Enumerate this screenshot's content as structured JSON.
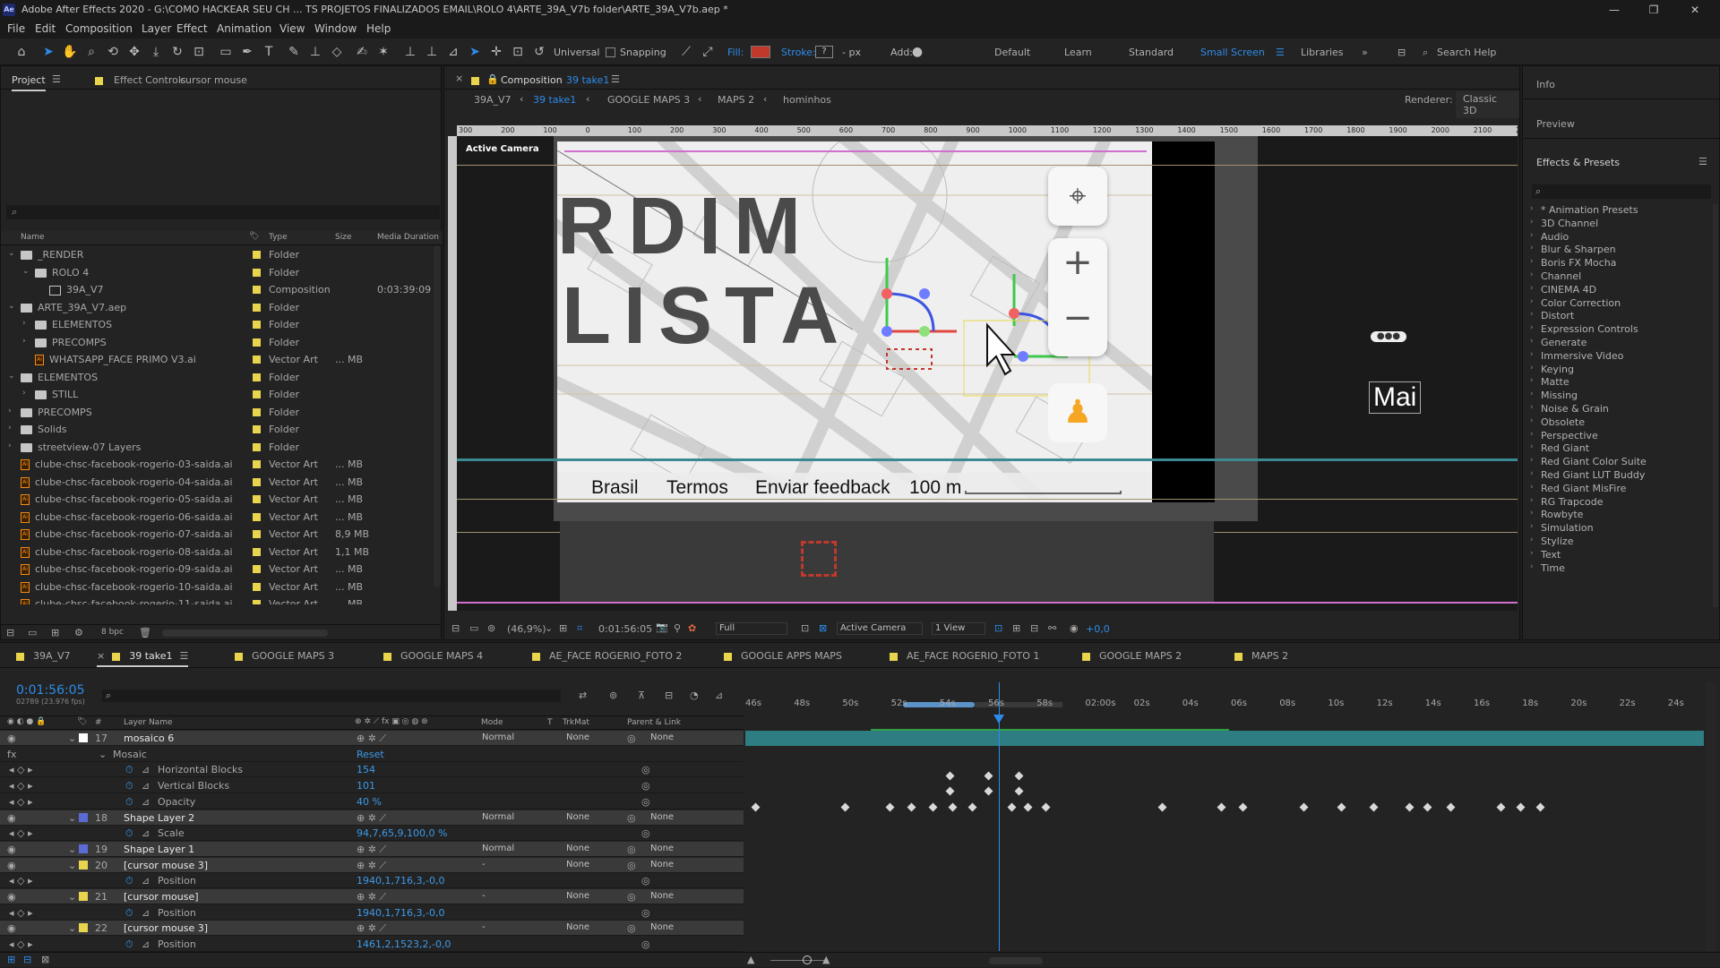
{
  "titlebar": {
    "logo": "Ae",
    "title": "Adobe After Effects 2020 - G:\\COMO HACKEAR SEU CH ... TS PROJETOS FINALIZADOS EMAIL\\ROLO 4\\ARTE_39A_V7b folder\\ARTE_39A_V7b.aep *",
    "minimize": "—",
    "restore": "❐",
    "close": "✕"
  },
  "menu": [
    "File",
    "Edit",
    "Composition",
    "Layer",
    "Effect",
    "Animation",
    "View",
    "Window",
    "Help"
  ],
  "toolbar": {
    "universal": "Universal",
    "snapping": "Snapping",
    "fill": "Fill:",
    "stroke": "Stroke:",
    "stroke_q": "?",
    "px": "- px",
    "add": "Add:",
    "workspaces": [
      "Default",
      "Learn",
      "Standard",
      "Small Screen",
      "Libraries"
    ],
    "active_workspace": "Small Screen",
    "search": "Search Help"
  },
  "project": {
    "tab": "Project",
    "effect_tab": "Effect Controls",
    "effect_target": "cursor mouse",
    "cols": {
      "name": "Name",
      "type": "Type",
      "size": "Size",
      "duration": "Media Duration"
    },
    "rows": [
      {
        "indent": 0,
        "exp": "⌄",
        "icon": "folder",
        "name": "_RENDER",
        "type": "Folder",
        "size": "",
        "dur": ""
      },
      {
        "indent": 1,
        "exp": "⌄",
        "icon": "folder",
        "name": "ROLO 4",
        "type": "Folder",
        "size": "",
        "dur": ""
      },
      {
        "indent": 2,
        "exp": "",
        "icon": "comp",
        "name": "39A_V7",
        "type": "Composition",
        "size": "",
        "dur": "0:03:39:09"
      },
      {
        "indent": 0,
        "exp": "⌄",
        "icon": "folder",
        "name": "ARTE_39A_V7.aep",
        "type": "Folder",
        "size": "",
        "dur": ""
      },
      {
        "indent": 1,
        "exp": "›",
        "icon": "folder",
        "name": "ELEMENTOS",
        "type": "Folder",
        "size": "",
        "dur": ""
      },
      {
        "indent": 1,
        "exp": "›",
        "icon": "folder",
        "name": "PRECOMPS",
        "type": "Folder",
        "size": "",
        "dur": ""
      },
      {
        "indent": 1,
        "exp": "",
        "icon": "ai",
        "name": "WHATSAPP_FACE PRIMO V3.ai",
        "type": "Vector Art",
        "size": "... MB",
        "dur": ""
      },
      {
        "indent": 0,
        "exp": "⌄",
        "icon": "folder",
        "name": "ELEMENTOS",
        "type": "Folder",
        "size": "",
        "dur": ""
      },
      {
        "indent": 1,
        "exp": "›",
        "icon": "folder",
        "name": "STILL",
        "type": "Folder",
        "size": "",
        "dur": ""
      },
      {
        "indent": 0,
        "exp": "›",
        "icon": "folder",
        "name": "PRECOMPS",
        "type": "Folder",
        "size": "",
        "dur": ""
      },
      {
        "indent": 0,
        "exp": "›",
        "icon": "folder",
        "name": "Solids",
        "type": "Folder",
        "size": "",
        "dur": ""
      },
      {
        "indent": 0,
        "exp": "›",
        "icon": "folder",
        "name": "streetview-07 Layers",
        "type": "Folder",
        "size": "",
        "dur": ""
      },
      {
        "indent": 0,
        "exp": "",
        "icon": "ai",
        "name": "clube-chsc-facebook-rogerio-03-saida.ai",
        "type": "Vector Art",
        "size": "... MB",
        "dur": ""
      },
      {
        "indent": 0,
        "exp": "",
        "icon": "ai",
        "name": "clube-chsc-facebook-rogerio-04-saida.ai",
        "type": "Vector Art",
        "size": "... MB",
        "dur": ""
      },
      {
        "indent": 0,
        "exp": "",
        "icon": "ai",
        "name": "clube-chsc-facebook-rogerio-05-saida.ai",
        "type": "Vector Art",
        "size": "... MB",
        "dur": ""
      },
      {
        "indent": 0,
        "exp": "",
        "icon": "ai",
        "name": "clube-chsc-facebook-rogerio-06-saida.ai",
        "type": "Vector Art",
        "size": "... MB",
        "dur": ""
      },
      {
        "indent": 0,
        "exp": "",
        "icon": "ai",
        "name": "clube-chsc-facebook-rogerio-07-saida.ai",
        "type": "Vector Art",
        "size": "8,9 MB",
        "dur": ""
      },
      {
        "indent": 0,
        "exp": "",
        "icon": "ai",
        "name": "clube-chsc-facebook-rogerio-08-saida.ai",
        "type": "Vector Art",
        "size": "1,1 MB",
        "dur": ""
      },
      {
        "indent": 0,
        "exp": "",
        "icon": "ai",
        "name": "clube-chsc-facebook-rogerio-09-saida.ai",
        "type": "Vector Art",
        "size": "... MB",
        "dur": ""
      },
      {
        "indent": 0,
        "exp": "",
        "icon": "ai",
        "name": "clube-chsc-facebook-rogerio-10-saida.ai",
        "type": "Vector Art",
        "size": "... MB",
        "dur": ""
      },
      {
        "indent": 0,
        "exp": "",
        "icon": "ai",
        "name": "clube-chsc-facebook-rogerio-11-saida.ai",
        "type": "Vector Art",
        "size": "... MB",
        "dur": ""
      }
    ],
    "bpc": "8 bpc"
  },
  "viewer": {
    "tab_prefix": "Composition",
    "tab_name": "39 take1",
    "breadcrumbs": [
      "39A_V7",
      "39 take1",
      "GOOGLE MAPS 3",
      "MAPS 2",
      "hominhos"
    ],
    "renderer_label": "Renderer:",
    "renderer": "Classic 3D",
    "active_camera": "Active Camera",
    "ruler": [
      "300",
      "200",
      "100",
      "0",
      "100",
      "200",
      "300",
      "400",
      "500",
      "600",
      "700",
      "800",
      "900",
      "1000",
      "1100",
      "1200",
      "1300",
      "1400",
      "1500",
      "1600",
      "1700",
      "1800",
      "1900",
      "2000",
      "2100",
      "2"
    ],
    "map_text_1": "RDIM",
    "map_text_2": "LISTA",
    "footer": [
      "Brasil",
      "Termos",
      "Enviar feedback",
      "100 m"
    ],
    "mai": "Mai",
    "zoom": "(46,9%)",
    "time": "0:01:56:05",
    "quality": "Full",
    "camera": "Active Camera",
    "views": "1 View",
    "exposure": "+0,0"
  },
  "info": {
    "info": "Info",
    "preview": "Preview",
    "effects": "Effects & Presets",
    "list": [
      "* Animation Presets",
      "3D Channel",
      "Audio",
      "Blur & Sharpen",
      "Boris FX Mocha",
      "Channel",
      "CINEMA 4D",
      "Color Correction",
      "Distort",
      "Expression Controls",
      "Generate",
      "Immersive Video",
      "Keying",
      "Matte",
      "Missing",
      "Noise & Grain",
      "Obsolete",
      "Perspective",
      "Red Giant",
      "Red Giant Color Suite",
      "Red Giant LUT Buddy",
      "Red Giant MisFire",
      "RG Trapcode",
      "Rowbyte",
      "Simulation",
      "Stylize",
      "Text",
      "Time"
    ]
  },
  "timeline": {
    "tabs": [
      "39A_V7",
      "39 take1",
      "GOOGLE MAPS 3",
      "GOOGLE MAPS 4",
      "AE_FACE ROGERIO_FOTO 2",
      "GOOGLE APPS MAPS",
      "AE_FACE ROGERIO_FOTO 1",
      "GOOGLE MAPS 2",
      "MAPS 2"
    ],
    "active_tab": "39 take1",
    "timecode": "0:01:56:05",
    "fps": "02789 (23.976 fps)",
    "header": {
      "num": "#",
      "layer_name": "Layer Name",
      "mode": "Mode",
      "t": "T",
      "trkmat": "TrkMat",
      "parent": "Parent & Link"
    },
    "ticks": [
      "46s",
      "48s",
      "50s",
      "52s",
      "54s",
      "56s",
      "58s",
      "02:00s",
      "02s",
      "04s",
      "06s",
      "08s",
      "10s",
      "12s",
      "14s",
      "16s",
      "18s",
      "20s",
      "22s",
      "24s"
    ],
    "rows": [
      {
        "type": "layer",
        "num": "17",
        "color": "#ffffff",
        "name": "mosaico 6",
        "mode": "Normal",
        "trk": "None",
        "parent": "None",
        "hl": true
      },
      {
        "type": "group",
        "name": "Mosaic",
        "value": "Reset"
      },
      {
        "type": "prop",
        "name": "Horizontal Blocks",
        "value": "154"
      },
      {
        "type": "prop",
        "name": "Vertical Blocks",
        "value": "101"
      },
      {
        "type": "prop",
        "name": "Opacity",
        "value": "40 %"
      },
      {
        "type": "layer",
        "num": "18",
        "color": "#5b6bd6",
        "name": "Shape Layer 2",
        "mode": "Normal",
        "trk": "None",
        "parent": "None",
        "hl": true
      },
      {
        "type": "prop",
        "name": "Scale",
        "value": "94,7,65,9,100,0 %"
      },
      {
        "type": "layer",
        "num": "19",
        "color": "#5b6bd6",
        "name": "Shape Layer 1",
        "mode": "Normal",
        "trk": "None",
        "parent": "None",
        "hl": true
      },
      {
        "type": "layer",
        "num": "20",
        "color": "#e8d44d",
        "name": "[cursor mouse 3]",
        "mode": "-",
        "trk": "None",
        "parent": "None",
        "hl": true
      },
      {
        "type": "prop",
        "name": "Position",
        "value": "1940,1,716,3,-0,0"
      },
      {
        "type": "layer",
        "num": "21",
        "color": "#e8d44d",
        "name": "[cursor mouse]",
        "mode": "-",
        "trk": "None",
        "parent": "None",
        "hl": true
      },
      {
        "type": "prop",
        "name": "Position",
        "value": "1940,1,716,3,-0,0"
      },
      {
        "type": "layer",
        "num": "22",
        "color": "#e8d44d",
        "name": "[cursor mouse 3]",
        "mode": "-",
        "trk": "None",
        "parent": "None",
        "hl": true
      },
      {
        "type": "prop",
        "name": "Position",
        "value": "1461,2,1523,2,-0,0"
      }
    ]
  }
}
